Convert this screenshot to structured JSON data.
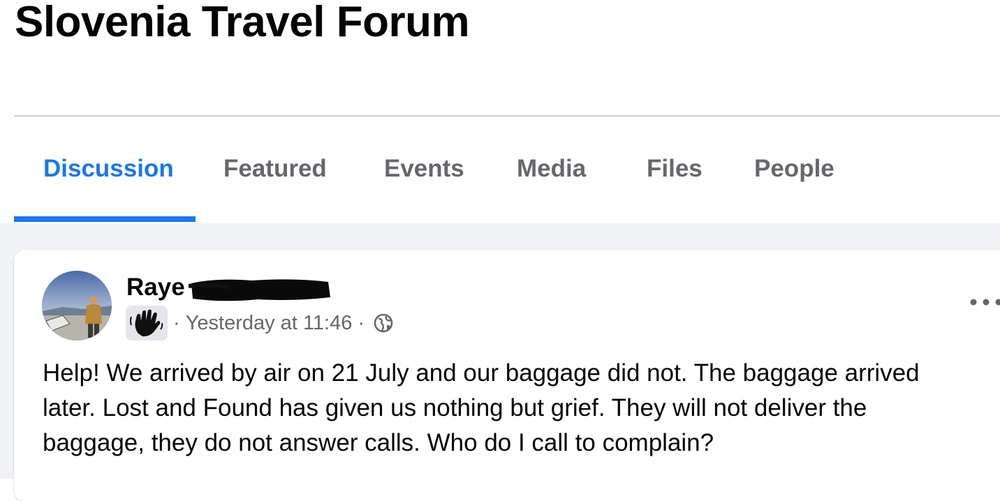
{
  "group": {
    "title": "Slovenia Travel Forum"
  },
  "tabs": [
    {
      "label": "Discussion",
      "active": true
    },
    {
      "label": "Featured",
      "active": false
    },
    {
      "label": "Events",
      "active": false
    },
    {
      "label": "Media",
      "active": false
    },
    {
      "label": "Files",
      "active": false
    },
    {
      "label": "People",
      "active": false
    }
  ],
  "post": {
    "author": {
      "first_name": "Raye",
      "avatar_icon": "avatar-photo-icon"
    },
    "badge_icon": "newcomer-wave-icon",
    "separator": "·",
    "timestamp": "Yesterday at 11:46",
    "privacy_icon": "globe-icon",
    "more_icon": "more-options-icon",
    "text_lines": [
      "Help!  We arrived by air on 21 July and our baggage did not.  The baggage arrived",
      "later.  Lost and Found has given us nothing but grief. They will not deliver the",
      "baggage, they do not answer calls.  Who do I call to complain?"
    ]
  },
  "colors": {
    "accent": "#1877f2",
    "tab_inactive": "#65676b",
    "text_primary": "#050505",
    "feed_background": "#f0f2f5",
    "divider": "#ced0d4"
  }
}
